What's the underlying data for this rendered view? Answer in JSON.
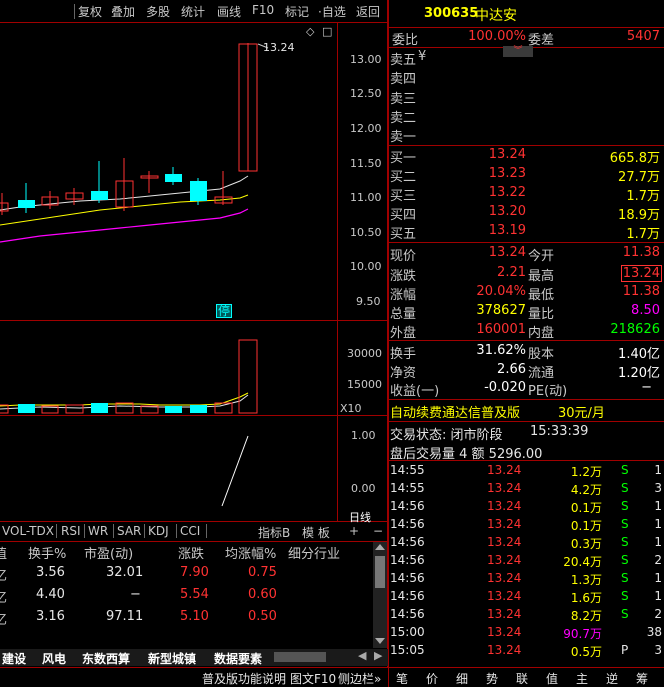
{
  "toolbar": {
    "buttons": [
      "复权",
      "叠加",
      "多股",
      "统计",
      "画线",
      "F10",
      "标记",
      "·自选",
      "返回"
    ]
  },
  "stock": {
    "code": "300635",
    "name": "中达安"
  },
  "price_axis": [
    "13.00",
    "12.50",
    "12.00",
    "11.50",
    "11.00",
    "10.50",
    "10.00",
    "9.50"
  ],
  "last_price_label": "13.24",
  "stop_badge": "停",
  "volume_axis": [
    "30000",
    "15000"
  ],
  "volume_unit": "X10",
  "ratio_axis": [
    "1.00",
    "0.00"
  ],
  "day_line_label": "日线",
  "indicator_tabs": [
    "VOL-TDX",
    "RSI",
    "WR",
    "SAR",
    "KDJ",
    "CCI"
  ],
  "indicator_right": {
    "index": "指标B",
    "template": "模 板",
    "plus": "+",
    "minus": "−"
  },
  "grid": {
    "headers": [
      "值",
      "换手%",
      "市盈(动)",
      "涨跌",
      "均涨幅%",
      "细分行业"
    ],
    "rows": [
      {
        "lead": "亿",
        "turnover": "3.56",
        "pe": "32.01",
        "change": "7.90",
        "avg": "0.75"
      },
      {
        "lead": "亿",
        "turnover": "4.40",
        "pe": "−",
        "change": "5.54",
        "avg": "0.60"
      },
      {
        "lead": "亿",
        "turnover": "3.16",
        "pe": "97.11",
        "change": "5.10",
        "avg": "0.50"
      }
    ]
  },
  "bottom_tabs": [
    "建设",
    "风电",
    "东数西算",
    "新型城镇",
    "数据要素"
  ],
  "status_bar": {
    "left": "普及版功能说明",
    "mid": "图文F10",
    "right": "侧边栏»"
  },
  "quote": {
    "wei_bi_label": "委比",
    "wei_bi": "100.00%",
    "wei_cha_label": "委差",
    "wei_cha": "5407",
    "sell": [
      {
        "label": "卖五",
        "price": "",
        "vol": "",
        "mark": "¥"
      },
      {
        "label": "卖四",
        "price": "",
        "vol": ""
      },
      {
        "label": "卖三",
        "price": "",
        "vol": ""
      },
      {
        "label": "卖二",
        "price": "",
        "vol": ""
      },
      {
        "label": "卖一",
        "price": "",
        "vol": ""
      }
    ],
    "buy": [
      {
        "label": "买一",
        "price": "13.24",
        "vol": "665.8万"
      },
      {
        "label": "买二",
        "price": "13.23",
        "vol": "27.7万"
      },
      {
        "label": "买三",
        "price": "13.22",
        "vol": "1.7万"
      },
      {
        "label": "买四",
        "price": "13.20",
        "vol": "18.9万"
      },
      {
        "label": "买五",
        "price": "13.19",
        "vol": "1.7万"
      }
    ],
    "stats": [
      {
        "l1": "现价",
        "v1": "13.24",
        "l2": "今开",
        "v2": "11.38"
      },
      {
        "l1": "涨跌",
        "v1": "2.21",
        "l2": "最高",
        "v2": "13.24"
      },
      {
        "l1": "涨幅",
        "v1": "20.04%",
        "l2": "最低",
        "v2": "11.38"
      },
      {
        "l1": "总量",
        "v1": "378627",
        "l2": "量比",
        "v2": "8.50"
      },
      {
        "l1": "外盘",
        "v1": "160001",
        "l2": "内盘",
        "v2": "218626"
      }
    ],
    "stats2": [
      {
        "l1": "换手",
        "v1": "31.62%",
        "l2": "股本",
        "v2": "1.40亿"
      },
      {
        "l1": "净资",
        "v1": "2.66",
        "l2": "流通",
        "v2": "1.20亿"
      },
      {
        "l1": "收益(一)",
        "v1": "-0.020",
        "l2": "PE(动)",
        "v2": "−"
      }
    ],
    "promo": "自动续费通达信普及版",
    "promo_price": "30元/月",
    "trade_state_label": "交易状态: 闭市阶段",
    "trade_state_time": "15:33:39",
    "after_hours": "盘后交易量 4 额 5296.00"
  },
  "ticks": [
    {
      "time": "14:55",
      "price": "13.24",
      "vol": "1.2万",
      "side": "S",
      "n": "1"
    },
    {
      "time": "14:55",
      "price": "13.24",
      "vol": "4.2万",
      "side": "S",
      "n": "3"
    },
    {
      "time": "14:56",
      "price": "13.24",
      "vol": "0.1万",
      "side": "S",
      "n": "1"
    },
    {
      "time": "14:56",
      "price": "13.24",
      "vol": "0.1万",
      "side": "S",
      "n": "1"
    },
    {
      "time": "14:56",
      "price": "13.24",
      "vol": "0.3万",
      "side": "S",
      "n": "1"
    },
    {
      "time": "14:56",
      "price": "13.24",
      "vol": "20.4万",
      "side": "S",
      "n": "2"
    },
    {
      "time": "14:56",
      "price": "13.24",
      "vol": "1.3万",
      "side": "S",
      "n": "1"
    },
    {
      "time": "14:56",
      "price": "13.24",
      "vol": "1.6万",
      "side": "S",
      "n": "1"
    },
    {
      "time": "14:56",
      "price": "13.24",
      "vol": "8.2万",
      "side": "S",
      "n": "2"
    },
    {
      "time": "15:00",
      "price": "13.24",
      "vol": "90.7万",
      "side": "",
      "n": "38"
    },
    {
      "time": "15:05",
      "price": "13.24",
      "vol": "0.5万",
      "side": "P",
      "n": "3"
    }
  ],
  "side_tabs": [
    "笔",
    "价",
    "细",
    "势",
    "联",
    "值",
    "主",
    "逆",
    "筹"
  ],
  "colors": {
    "up": "#ff3232",
    "down": "#00ffff",
    "grid": "#a00000",
    "yellow": "#ffff00",
    "green": "#00ff00"
  }
}
